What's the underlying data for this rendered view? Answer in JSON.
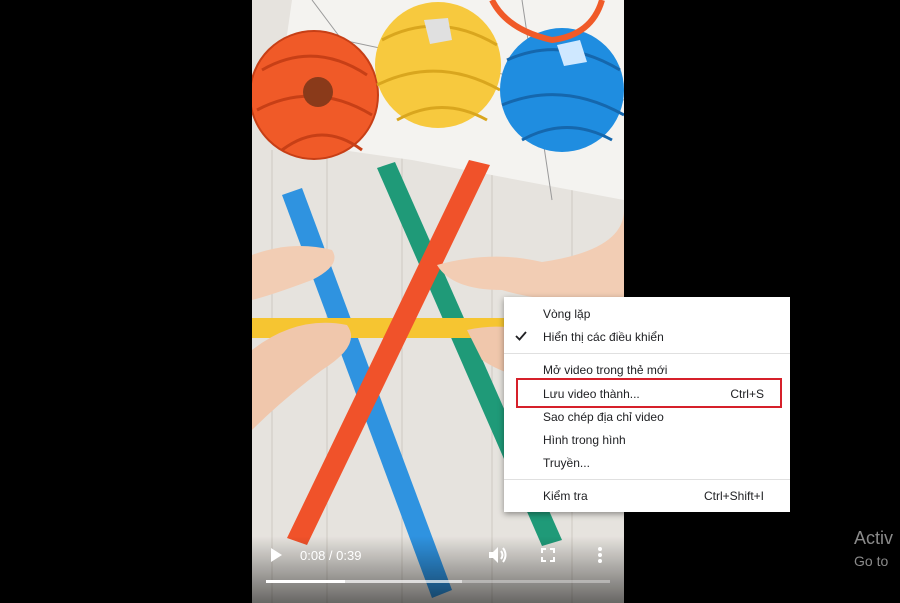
{
  "video": {
    "current_time": "0:08",
    "duration": "0:39",
    "time_display": "0:08 / 0:39",
    "played_fraction": 0.23,
    "buffered_fraction": 0.57,
    "icons": {
      "play": "play-icon",
      "volume": "volume-icon",
      "fullscreen": "fullscreen-icon",
      "more": "more-vert-icon"
    }
  },
  "context_menu": {
    "items": [
      {
        "label": "Vòng lặp",
        "shortcut": "",
        "checked": false
      },
      {
        "label": "Hiển thị các điều khiển",
        "shortcut": "",
        "checked": true
      },
      {
        "label": "Mở video trong thẻ mới",
        "shortcut": "",
        "checked": false
      },
      {
        "label": "Lưu video thành...",
        "shortcut": "Ctrl+S",
        "checked": false,
        "highlighted": true
      },
      {
        "label": "Sao chép địa chỉ video",
        "shortcut": "",
        "checked": false
      },
      {
        "label": "Hình trong hình",
        "shortcut": "",
        "checked": false
      },
      {
        "label": "Truyền...",
        "shortcut": "",
        "checked": false
      },
      {
        "label": "Kiểm tra",
        "shortcut": "Ctrl+Shift+I",
        "checked": false
      }
    ],
    "highlight_color": "#d6202a"
  },
  "watermark": {
    "line1": "Activ",
    "line2": "Go to"
  },
  "colors": {
    "ball_orange": "#f05a28",
    "ball_yellow": "#f7c93e",
    "ball_blue": "#1f8de0",
    "strip_blue": "#2f93e0",
    "strip_green": "#1f9a78",
    "strip_orange": "#f0522a",
    "strip_yellow": "#f6c531"
  }
}
